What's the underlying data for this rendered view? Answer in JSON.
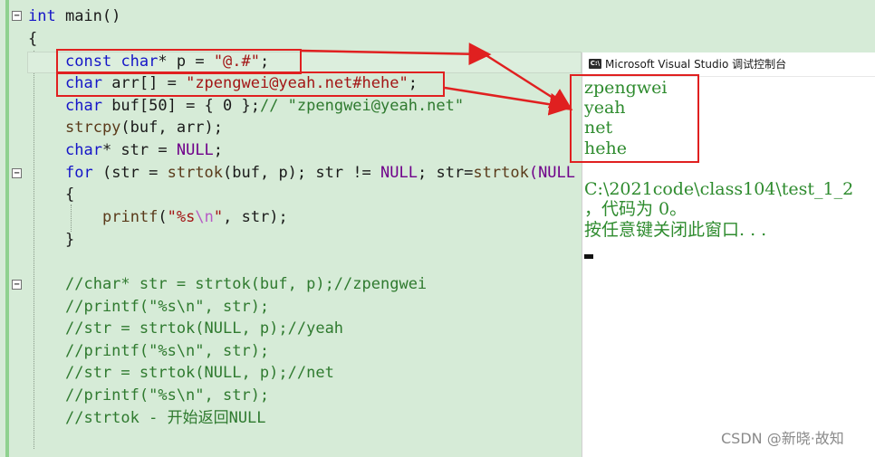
{
  "editor": {
    "lines": {
      "main_kw": "int",
      "main_rest": " main()",
      "open_brace": "{",
      "p_const": "const",
      "p_char": "char",
      "p_mid": "* p = ",
      "p_str": "\"@.#\"",
      "p_end": ";",
      "arr_char": "char",
      "arr_mid": " arr[] = ",
      "arr_str": "\"zpengwei@yeah.net#hehe\"",
      "arr_end": ";",
      "buf_char": "char",
      "buf_mid": " buf[50] = { 0 };",
      "buf_comment": "// \"zpengwei@yeah.net\"",
      "strcpy_fn": "strcpy",
      "strcpy_rest": "(buf, arr);",
      "str_char": "char",
      "str_mid": "* str = ",
      "str_null": "NULL",
      "str_end": ";",
      "for_kw": "for",
      "for_a": " (str = ",
      "for_fn1": "strtok",
      "for_b": "(buf, p); str != ",
      "for_null": "NULL",
      "for_c": "; str=",
      "for_fn2": "strtok",
      "for_d": "(NULL",
      "inner_open": "{",
      "printf_fn": "printf",
      "printf_a": "(",
      "printf_str1": "\"%s",
      "printf_esc": "\\n",
      "printf_str2": "\"",
      "printf_b": ", str);",
      "inner_close": "}",
      "c1": "//char* str = strtok(buf, p);//zpengwei",
      "c2": "//printf(\"%s\\n\", str);",
      "c3": "//str = strtok(NULL, p);//yeah",
      "c4": "//printf(\"%s\\n\", str);",
      "c5": "//str = strtok(NULL, p);//net",
      "c6": "//printf(\"%s\\n\", str);",
      "c7": "//strtok - 开始返回NULL"
    },
    "fold_glyph": "⊟"
  },
  "console": {
    "icon_label": "C:\\",
    "title": "Microsoft Visual Studio 调试控制台",
    "output": [
      "zpengwei",
      "yeah",
      "net",
      "hehe"
    ],
    "path_line": "C:\\2021code\\class104\\test_1_2",
    "exit_line": "，代码为 0。",
    "prompt_line": "按任意键关闭此窗口. . ."
  },
  "watermark": "CSDN @新晓·故知",
  "colors": {
    "editor_bg": "#d6ebd7",
    "keyword": "#1515c8",
    "string": "#a31515",
    "comment": "#2f7a2f",
    "console_text": "#2e8b2e",
    "annotation": "#e02020"
  }
}
